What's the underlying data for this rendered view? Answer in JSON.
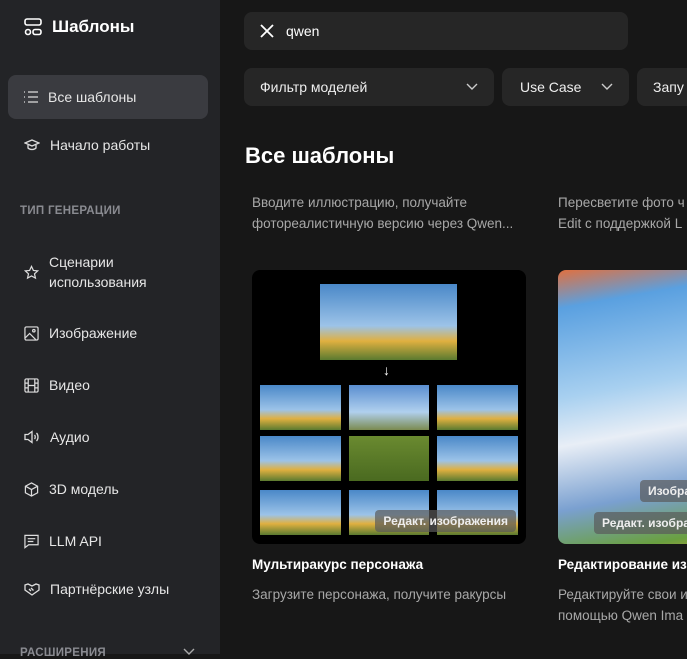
{
  "sidebar": {
    "title": "Шаблоны",
    "items": [
      {
        "label": "Все шаблоны"
      },
      {
        "label": "Начало работы"
      }
    ],
    "section_generation": "ТИП ГЕНЕРАЦИИ",
    "gen_items": [
      {
        "label": "Сценарии использования"
      },
      {
        "label": "Изображение"
      },
      {
        "label": "Видео"
      },
      {
        "label": "Аудио"
      },
      {
        "label": "3D модель"
      },
      {
        "label": "LLM API"
      },
      {
        "label": "Партнёрские узлы"
      }
    ],
    "section_extensions": "РАСШИРЕНИЯ"
  },
  "search": {
    "value": "qwen"
  },
  "filters": [
    {
      "label": "Фильтр моделей"
    },
    {
      "label": "Use Case"
    },
    {
      "label": "Запу"
    }
  ],
  "page_title": "Все шаблоны",
  "top_cards": [
    {
      "desc1": "Вводите иллюстрацию, получайте",
      "desc2": "фотореалистичную версию через Qwen..."
    },
    {
      "desc1": "Пересветите фото ч",
      "desc2": "Edit с поддержкой L"
    }
  ],
  "cards": [
    {
      "badge": "Редакт. изображения",
      "title": "Мультиракурс персонажа",
      "desc1": "Загрузите персонажа, получите ракурсы"
    },
    {
      "badge2": "Изобра",
      "badge": "Редакт. изобра",
      "title": "Редактирование из",
      "desc1": "Редактируйте свои и",
      "desc2": "помощью Qwen Ima"
    }
  ]
}
